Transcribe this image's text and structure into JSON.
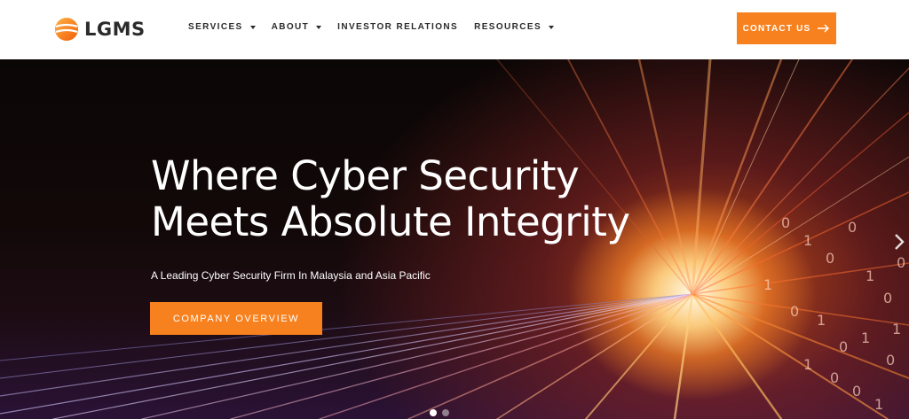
{
  "brand": {
    "name": "LGMS",
    "accent": "#f7811f"
  },
  "nav": {
    "items": [
      {
        "label": "SERVICES",
        "has_dropdown": true
      },
      {
        "label": "ABOUT",
        "has_dropdown": true
      },
      {
        "label": "INVESTOR RELATIONS",
        "has_dropdown": false
      },
      {
        "label": "RESOURCES",
        "has_dropdown": true
      }
    ],
    "contact_label": "CONTACT US"
  },
  "hero": {
    "headline_line1": "Where Cyber Security",
    "headline_line2": "Meets Absolute Integrity",
    "subline": "A Leading Cyber Security Firm In Malaysia and Asia Pacific",
    "cta_label": "COMPANY OVERVIEW",
    "slide_count": 2,
    "active_slide": 1
  },
  "icons": {
    "logo": "lgms-sphere-logo",
    "dropdown": "chevron-down-icon",
    "contact_arrow": "arrow-right-icon",
    "slider_next": "chevron-right-icon"
  }
}
